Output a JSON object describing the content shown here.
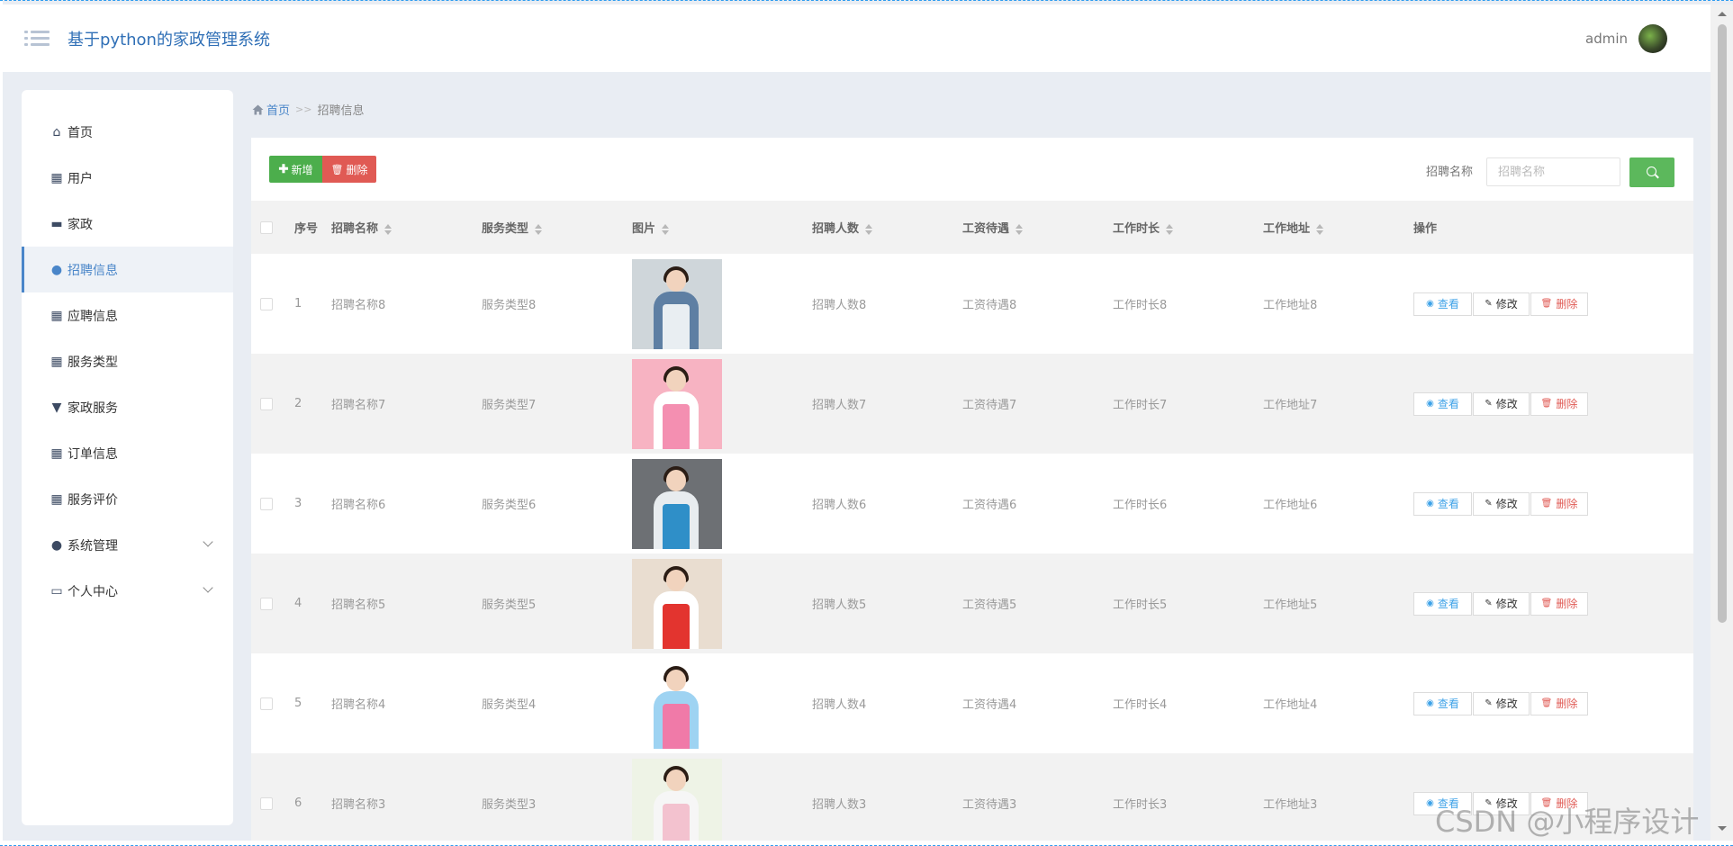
{
  "header": {
    "app_title": "基于python的家政管理系统",
    "username": "admin"
  },
  "sidebar": {
    "items": [
      {
        "label": "首页",
        "icon": "home-icon"
      },
      {
        "label": "用户",
        "icon": "grid-icon"
      },
      {
        "label": "家政",
        "icon": "briefcase-icon"
      },
      {
        "label": "招聘信息",
        "icon": "user-icon",
        "active": true
      },
      {
        "label": "应聘信息",
        "icon": "grid-icon"
      },
      {
        "label": "服务类型",
        "icon": "grid-9-icon"
      },
      {
        "label": "家政服务",
        "icon": "pin-icon"
      },
      {
        "label": "订单信息",
        "icon": "grid-icon"
      },
      {
        "label": "服务评价",
        "icon": "grid-icon"
      },
      {
        "label": "系统管理",
        "icon": "user-icon",
        "expandable": true
      },
      {
        "label": "个人中心",
        "icon": "card-icon",
        "expandable": true
      }
    ]
  },
  "breadcrumb": {
    "home": "首页",
    "separator": ">>",
    "current": "招聘信息"
  },
  "toolbar": {
    "add_label": "新增",
    "delete_label": "删除",
    "search_label": "招聘名称",
    "search_placeholder": "招聘名称"
  },
  "table": {
    "columns": [
      "序号",
      "招聘名称",
      "服务类型",
      "图片",
      "招聘人数",
      "工资待遇",
      "工作时长",
      "工作地址",
      "操作"
    ],
    "rows": [
      {
        "index": "1",
        "name": "招聘名称8",
        "type": "服务类型8",
        "count": "招聘人数8",
        "salary": "工资待遇8",
        "hours": "工作时长8",
        "address": "工作地址8",
        "photo": {
          "bg": "#cfd6da",
          "body": "#5e7fa3",
          "apron": "#e9eef2"
        }
      },
      {
        "index": "2",
        "name": "招聘名称7",
        "type": "服务类型7",
        "count": "招聘人数7",
        "salary": "工资待遇7",
        "hours": "工作时长7",
        "address": "工作地址7",
        "photo": {
          "bg": "#f7b3c2",
          "body": "#ffffff",
          "apron": "#f48fb1"
        }
      },
      {
        "index": "3",
        "name": "招聘名称6",
        "type": "服务类型6",
        "count": "招聘人数6",
        "salary": "工资待遇6",
        "hours": "工作时长6",
        "address": "工作地址6",
        "photo": {
          "bg": "#6d7074",
          "body": "#e8ecef",
          "apron": "#2f8fc8"
        }
      },
      {
        "index": "4",
        "name": "招聘名称5",
        "type": "服务类型5",
        "count": "招聘人数5",
        "salary": "工资待遇5",
        "hours": "工作时长5",
        "address": "工作地址5",
        "photo": {
          "bg": "#e9ddd0",
          "body": "#ffffff",
          "apron": "#e3342f"
        }
      },
      {
        "index": "5",
        "name": "招聘名称4",
        "type": "服务类型4",
        "count": "招聘人数4",
        "salary": "工资待遇4",
        "hours": "工作时长4",
        "address": "工作地址4",
        "photo": {
          "bg": "#ffffff",
          "body": "#9ed3f2",
          "apron": "#f07aa8"
        }
      },
      {
        "index": "6",
        "name": "招聘名称3",
        "type": "服务类型3",
        "count": "招聘人数3",
        "salary": "工资待遇3",
        "hours": "工作时长3",
        "address": "工作地址3",
        "photo": {
          "bg": "#eef3e6",
          "body": "#f6f6f6",
          "apron": "#f3c2cf"
        }
      }
    ],
    "actions": {
      "view": "查看",
      "edit": "修改",
      "delete": "删除"
    }
  },
  "watermark": "CSDN @小程序设计",
  "colors": {
    "accent": "#4a86c9",
    "add_button": "#4cae4c",
    "delete_button": "#e05a54",
    "search_button": "#5cb85c",
    "view_text": "#3fa3e8"
  }
}
